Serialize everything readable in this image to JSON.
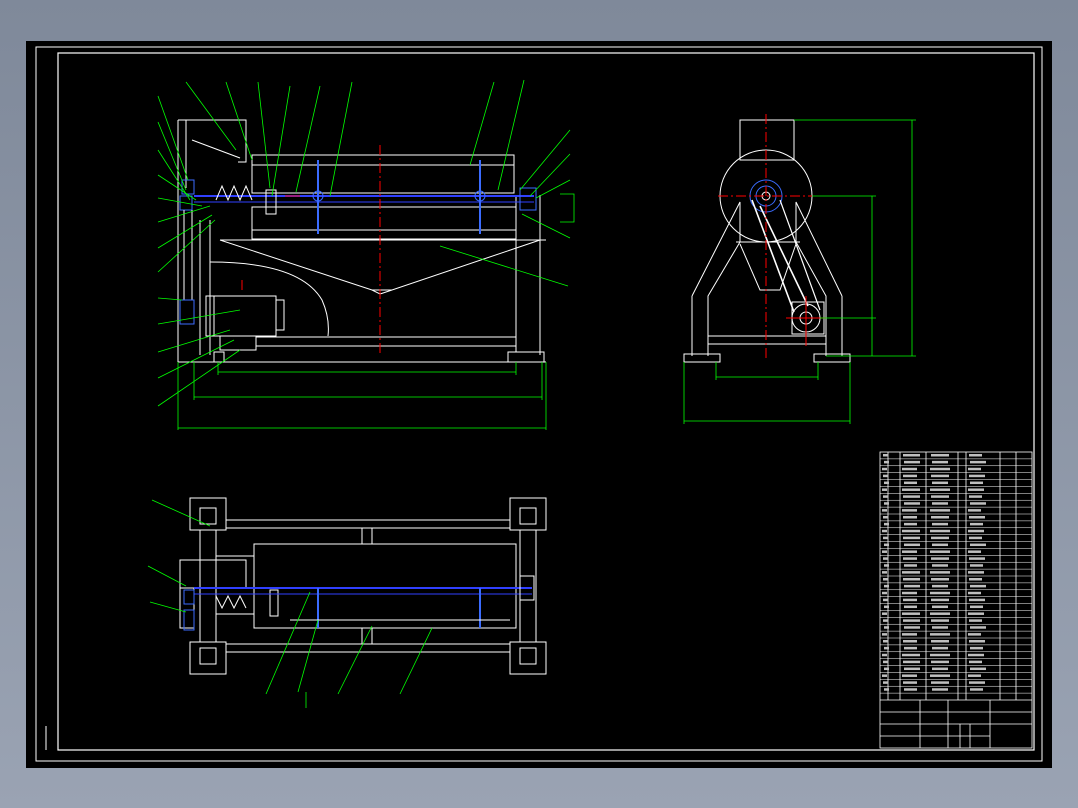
{
  "colors": {
    "background": "#8b95a6",
    "paper": "#000000",
    "outline": "#ffffff",
    "leader": "#00ff00",
    "centerline": "#ff0000",
    "hidden": "#00a0ff",
    "shaft": "#3040ff",
    "part": "#3b6cff"
  },
  "icons": [
    "ucs-icon"
  ]
}
